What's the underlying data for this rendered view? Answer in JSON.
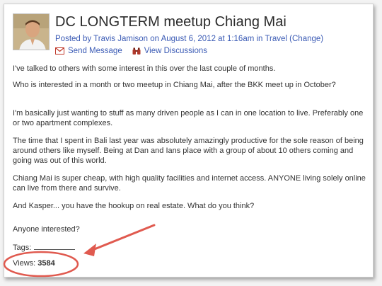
{
  "post": {
    "title": "DC LONGTERM meetup Chiang Mai",
    "posted_prefix": "Posted by ",
    "author": "Travis Jamison",
    "date_text": " on August 6, 2012 at 1:16am in ",
    "category": "Travel",
    "change_link": "(Change)"
  },
  "actions": {
    "send_message": "Send Message",
    "view_discussions": "View Discussions"
  },
  "body": {
    "p1": "I've talked to others with some interest in this over the last couple of months.",
    "p2": "Who is interested in a month or two meetup in Chiang Mai, after the BKK meet up in October?",
    "p3": "I'm basically just wanting to stuff as many driven people as I can in one location to live. Preferably one or two apartment complexes.",
    "p4": "The time that I spent in Bali last year was absolutely amazingly productive for the sole reason of being around others like myself. Being at Dan and Ians place with a group of about 10 others coming and going was out of this world.",
    "p5": "Chiang Mai is super cheap, with high quality facilities and internet access. ANYONE living solely online can live from there and survive.",
    "p6": "And Kasper... you have the hookup on real estate. What do you think?",
    "p7": "Anyone interested?"
  },
  "meta": {
    "tags_label": "Tags:",
    "views_label": "Views:",
    "views_count": "3584"
  },
  "icons": {
    "send_message": "envelope-icon",
    "view_discussions": "binoculars-icon"
  },
  "colors": {
    "link": "#3b5bb5",
    "annotation": "#e05a4f"
  }
}
